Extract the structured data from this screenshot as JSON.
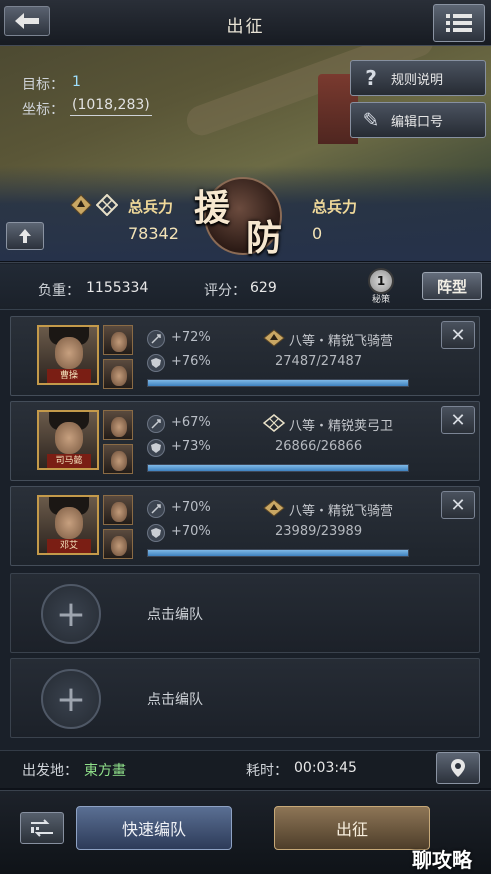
{
  "header": {
    "title": "出征",
    "back_icon": "back-arrow-icon",
    "menu_icon": "list-icon"
  },
  "target": {
    "label": "目标：",
    "value": "1",
    "coord_label": "坐标：",
    "coord_value": "(1018,283)"
  },
  "side_menu": [
    {
      "icon": "question-icon",
      "glyph": "?",
      "label": "规则说明"
    },
    {
      "icon": "brush-icon",
      "glyph": "✎",
      "label": "编辑口号"
    }
  ],
  "forces": {
    "left_label": "总兵力",
    "left_value": "78342",
    "right_label": "总兵力",
    "right_value": "0",
    "emblem_char_1": "援",
    "emblem_char_2": "防"
  },
  "stats": {
    "load_label": "负重：",
    "load_value": "1155334",
    "score_label": "评分：",
    "score_value": "629",
    "secret_count": "1",
    "secret_label": "秘策",
    "formation_label": "阵型"
  },
  "squads": [
    {
      "general": "曹操",
      "atk_buff": "+72%",
      "def_buff": "+76%",
      "troop": "八等・精锐飞骑营",
      "count": "27487/27487",
      "hp_fraction": 1.0
    },
    {
      "general": "司马懿",
      "atk_buff": "+67%",
      "def_buff": "+73%",
      "troop": "八等・精锐荚弓卫",
      "count": "26866/26866",
      "hp_fraction": 1.0
    },
    {
      "general": "邓艾",
      "atk_buff": "+70%",
      "def_buff": "+70%",
      "troop": "八等・精锐飞骑营",
      "count": "23989/23989",
      "hp_fraction": 1.0
    }
  ],
  "empty_slots": [
    {
      "label": "点击编队"
    },
    {
      "label": "点击编队"
    }
  ],
  "depart": {
    "from_label": "出发地：",
    "from_value": "東方畫",
    "time_label": "耗时：",
    "time_value": "00:03:45"
  },
  "footer": {
    "quick_label": "快速编队",
    "go_label": "出征",
    "swap_icon": "swap-icon"
  },
  "watermark": "聊攻略",
  "colors": {
    "accent_blue": "#4a8ac6",
    "gold_text": "#f0d99a",
    "go_button": "#8d7556"
  }
}
